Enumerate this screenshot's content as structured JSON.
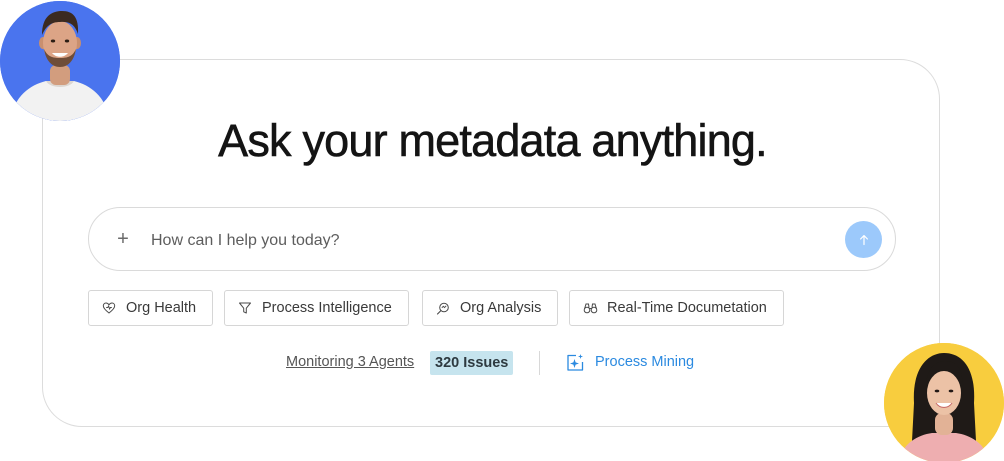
{
  "headline": "Ask your metadata anything.",
  "search": {
    "placeholder": "How can I help you today?",
    "value": "",
    "add_label": "+",
    "submit_icon": "arrow-up-icon"
  },
  "chips": [
    {
      "label": "Org Health",
      "icon": "heart-icon"
    },
    {
      "label": "Process Intelligence",
      "icon": "filter-icon"
    },
    {
      "label": "Org Analysis",
      "icon": "analysis-icon"
    },
    {
      "label": "Real-Time Documetation",
      "icon": "binoculars-icon"
    }
  ],
  "status": {
    "monitoring_label": "Monitoring 3 Agents",
    "issues_label": "320 Issues",
    "process_mining_label": "Process Mining",
    "process_mining_icon": "sparkle-icon"
  },
  "colors": {
    "accent": "#2b8ae0",
    "send_button": "#9cc9fb",
    "badge_bg": "#c6e4ee",
    "avatar_left_bg": "#4a74ee",
    "avatar_right_bg": "#f8cd3e"
  }
}
